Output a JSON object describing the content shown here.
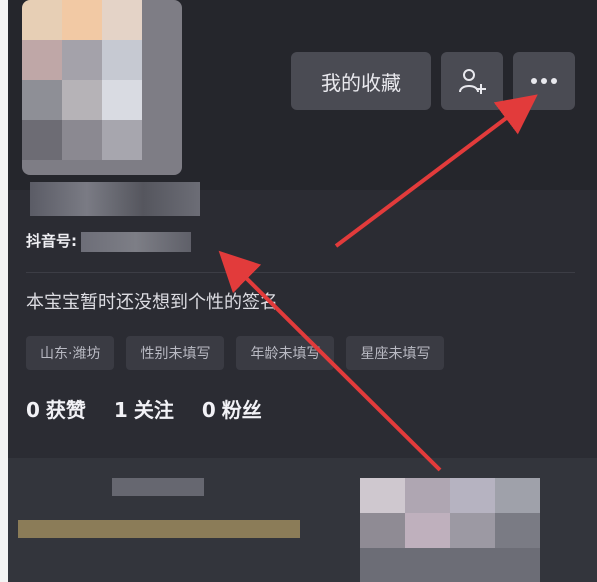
{
  "header": {
    "favorites_label": "我的收藏",
    "add_friend_icon": "add-user-icon",
    "more_icon": "more-dots-icon"
  },
  "profile": {
    "douyin_id_label": "抖音号:",
    "signature": "本宝宝暂时还没想到个性的签名",
    "tags": [
      "山东·潍坊",
      "性别未填写",
      "年龄未填写",
      "星座未填写"
    ],
    "stats": [
      {
        "value": "0",
        "label": "获赞"
      },
      {
        "value": "1",
        "label": "关注"
      },
      {
        "value": "0",
        "label": "粉丝"
      }
    ]
  },
  "annotation_color": "#e23b3b"
}
